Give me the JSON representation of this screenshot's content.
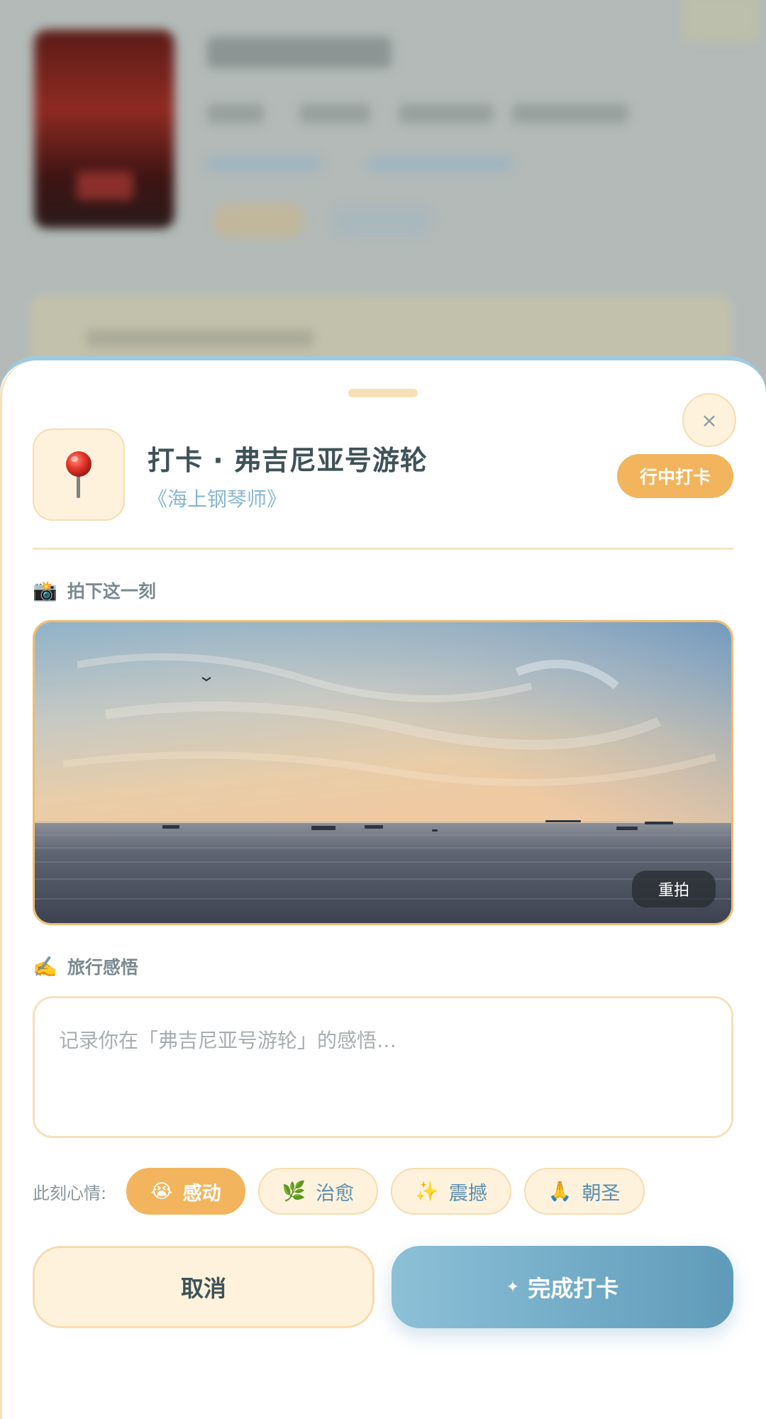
{
  "sheet": {
    "title": "打卡 · 弗吉尼亚号游轮",
    "subtitle": "《海上钢琴师》",
    "badge": "行中打卡",
    "close_glyph": "×",
    "icons": {
      "header": "pushpin-icon",
      "close": "close-icon"
    }
  },
  "photo_section": {
    "label": "拍下这一刻",
    "emoji": "📸",
    "retake_label": "重拍",
    "photo_alt": "sea-sunset-photo"
  },
  "reflection": {
    "label": "旅行感悟",
    "emoji": "✍️",
    "placeholder": "记录你在「弗吉尼亚号游轮」的感悟…"
  },
  "mood": {
    "label": "此刻心情:",
    "options": [
      {
        "emoji": "😭",
        "label": "感动",
        "selected": true
      },
      {
        "emoji": "🌿",
        "label": "治愈",
        "selected": false
      },
      {
        "emoji": "✨",
        "label": "震撼",
        "selected": false
      },
      {
        "emoji": "🙏",
        "label": "朝圣",
        "selected": false
      }
    ]
  },
  "actions": {
    "cancel_label": "取消",
    "confirm_icon": "✦",
    "confirm_label": "完成打卡"
  },
  "colors": {
    "accent": "#f2b45c",
    "blue": "#5f9bb9",
    "title": "#3f5257"
  }
}
